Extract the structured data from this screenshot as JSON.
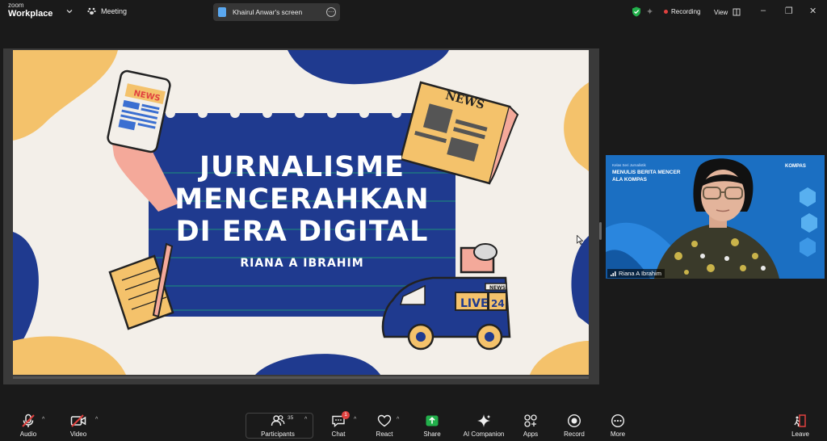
{
  "app": {
    "logo_top": "zoom",
    "logo_bottom": "Workplace",
    "meeting_label": "Meeting"
  },
  "screen_share": {
    "label": "Khairul Anwar's screen"
  },
  "status": {
    "recording": "Recording",
    "view": "View"
  },
  "slide": {
    "title_line1": "JURNALISME",
    "title_line2": "MENCERAHKAN",
    "title_line3": "DI ERA DIGITAL",
    "author": "RIANA A IBRAHIM",
    "phone_tag": "NEWS",
    "paper_tag": "NEWS",
    "van_live": "LIVE",
    "van_number": "24",
    "van_news": "NEWS"
  },
  "participant": {
    "name": "Riana A Ibrahim",
    "bg_small": "Kelas Seri Jurnalistik",
    "bg_title_1": "MENULIS BERITA MENCER",
    "bg_title_2": "ALA KOMPAS",
    "bg_brand": "KOMPAS"
  },
  "toolbar": {
    "audio": "Audio",
    "video": "Video",
    "participants": "Participants",
    "participants_count": "35",
    "chat": "Chat",
    "chat_badge": "1",
    "react": "React",
    "share": "Share",
    "ai_companion": "AI Companion",
    "apps": "Apps",
    "record": "Record",
    "more": "More",
    "leave": "Leave"
  },
  "colors": {
    "slide_navy": "#1f3a8f",
    "slide_yellow": "#f4c26b",
    "slide_bg": "#f3efe9",
    "share_green": "#22b04b",
    "leave_red": "#e0413f"
  }
}
